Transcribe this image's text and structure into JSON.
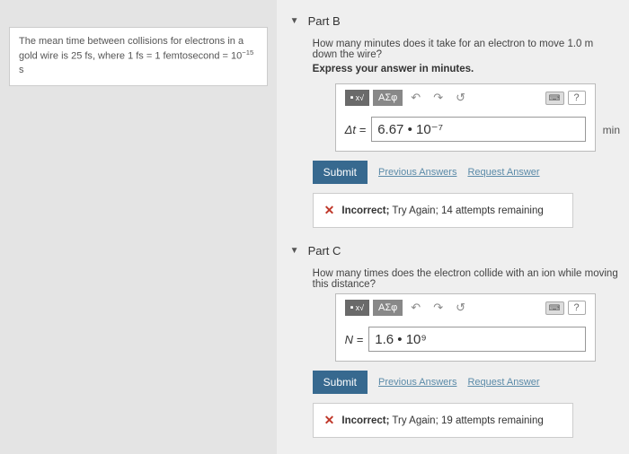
{
  "info": {
    "text_prefix": "The mean time between collisions for electrons in a gold wire is ",
    "value": "25 fs",
    "text_mid": ", where 1 fs = 1 femtosecond = ",
    "exp_base": "10",
    "exp_sup": "−15",
    "unit": " s"
  },
  "partB": {
    "title": "Part B",
    "question": "How many minutes does it take for an electron to move 1.0 m down the wire?",
    "instruct": "Express your answer in minutes.",
    "toolbar": {
      "templates": "ΑΣφ",
      "help": "?"
    },
    "var": "Δt =",
    "value": "6.67 • 10⁻⁷",
    "unit": "min",
    "submit": "Submit",
    "prev": "Previous Answers",
    "req": "Request Answer",
    "feedback": "Incorrect; Try Again; 14 attempts remaining"
  },
  "partC": {
    "title": "Part C",
    "question": "How many times does the electron collide with an ion while moving this distance?",
    "toolbar": {
      "templates": "ΑΣφ",
      "help": "?"
    },
    "var": "N =",
    "value": "1.6 • 10⁹",
    "submit": "Submit",
    "prev": "Previous Answers",
    "req": "Request Answer",
    "feedback": "Incorrect; Try Again; 19 attempts remaining"
  }
}
